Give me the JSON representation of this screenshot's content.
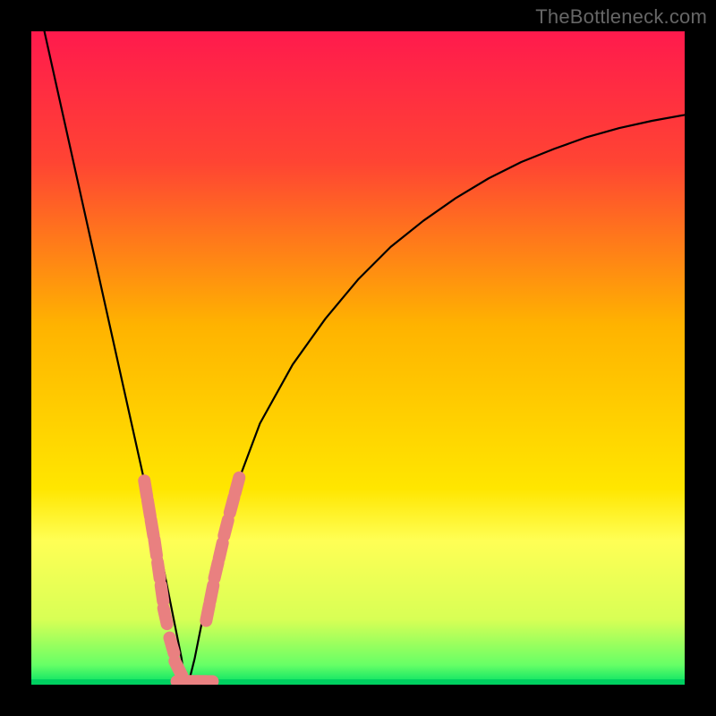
{
  "watermark": "TheBottleneck.com",
  "chart_data": {
    "type": "line",
    "title": "",
    "xlabel": "",
    "ylabel": "",
    "xlim": [
      0,
      100
    ],
    "ylim": [
      0,
      100
    ],
    "gradient_stops": [
      {
        "offset": 0,
        "color": "#ff1a4d"
      },
      {
        "offset": 20,
        "color": "#ff4433"
      },
      {
        "offset": 45,
        "color": "#ffb300"
      },
      {
        "offset": 70,
        "color": "#ffe600"
      },
      {
        "offset": 78,
        "color": "#ffff55"
      },
      {
        "offset": 90,
        "color": "#d8ff55"
      },
      {
        "offset": 97,
        "color": "#66ff66"
      },
      {
        "offset": 100,
        "color": "#00e066"
      }
    ],
    "bottom_band_color": "#00d060",
    "series": [
      {
        "name": "left_curve",
        "x": [
          2,
          4,
          6,
          8,
          10,
          12,
          14,
          16,
          18,
          20,
          21,
          22,
          23,
          23.5
        ],
        "y": [
          100,
          91,
          82,
          73,
          64,
          55,
          46,
          37,
          28,
          19,
          14,
          9,
          4,
          0
        ]
      },
      {
        "name": "right_curve",
        "x": [
          24,
          25,
          26,
          28,
          30,
          32,
          35,
          40,
          45,
          50,
          55,
          60,
          65,
          70,
          75,
          80,
          85,
          90,
          95,
          100
        ],
        "y": [
          0,
          4,
          9,
          17,
          25,
          32,
          40,
          49,
          56,
          62,
          67,
          71,
          74.5,
          77.5,
          80,
          82,
          83.8,
          85.2,
          86.3,
          87.2
        ]
      }
    ],
    "dotted_segments": {
      "left": {
        "x": [
          17.5,
          18,
          18.5,
          19,
          19.5,
          20,
          20.5,
          21.5,
          22.5,
          23.5,
          24.5,
          25.5,
          26.5
        ],
        "y": [
          30,
          27,
          24,
          21,
          17.5,
          14,
          10.5,
          6,
          2.5,
          0.5,
          0.5,
          0.5,
          0.5
        ]
      },
      "right": {
        "x": [
          27,
          27.6,
          28.3,
          29.0,
          29.8,
          30.7,
          31.5
        ],
        "y": [
          11,
          14,
          17.5,
          20.5,
          24,
          27.5,
          30.5
        ]
      }
    },
    "min_point_x": 23.7
  }
}
